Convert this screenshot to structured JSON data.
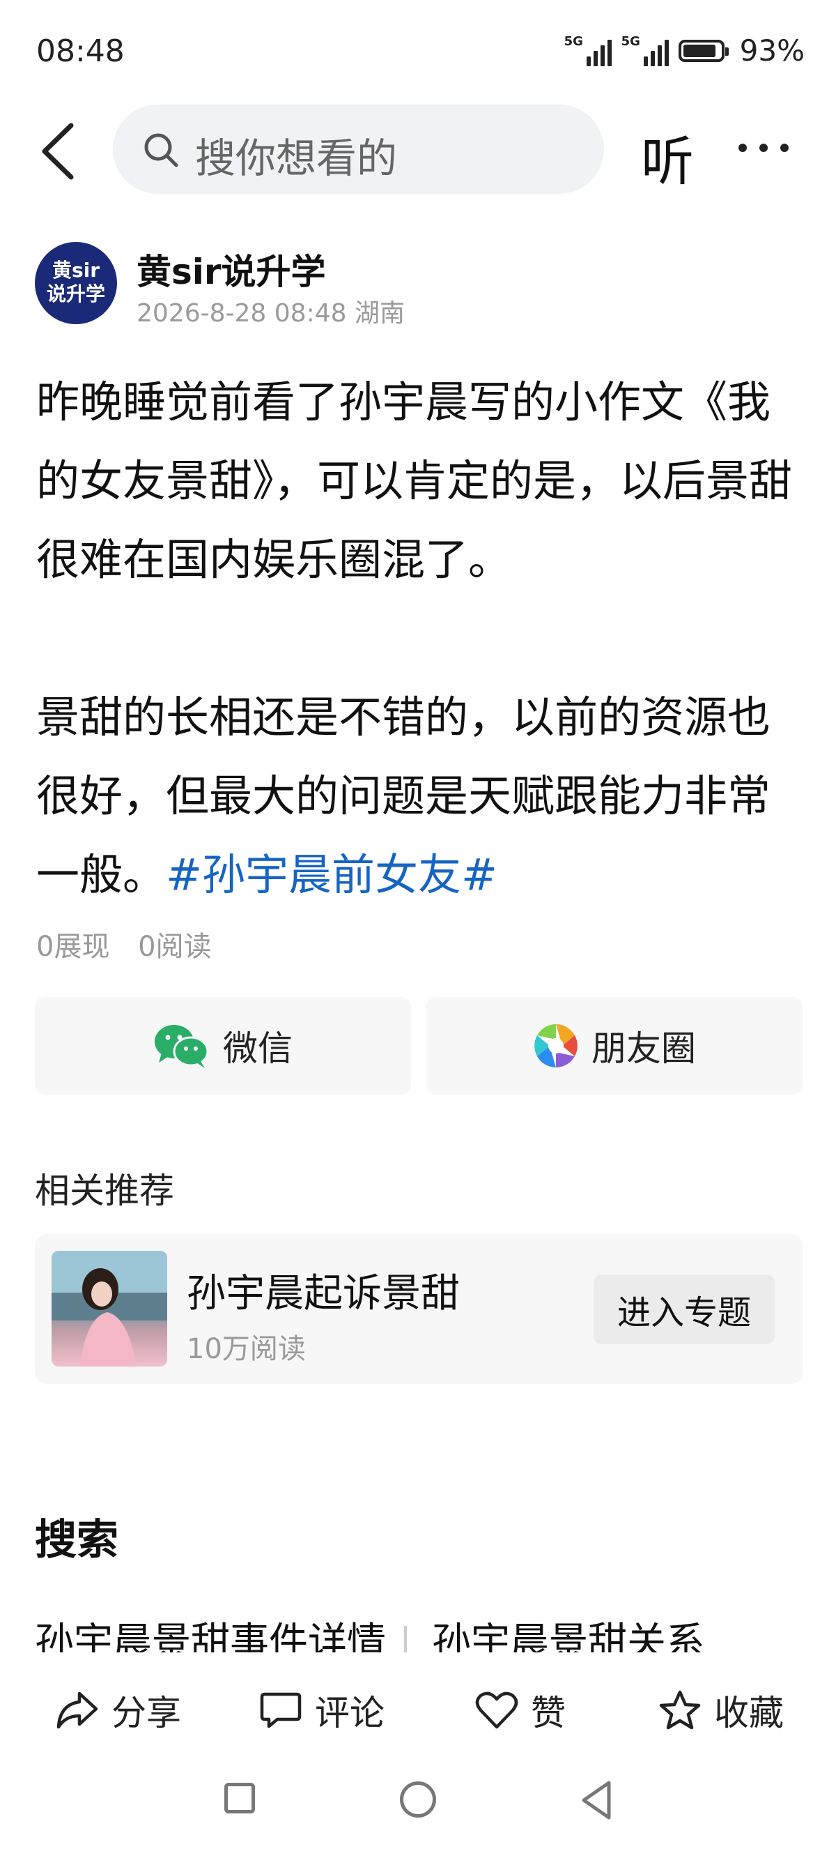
{
  "status_bar": {
    "time": "08:48",
    "network_1": "5G",
    "network_2": "5G",
    "battery_percent": "93%"
  },
  "nav": {
    "search_placeholder": "搜你想看的",
    "listen_label": "听"
  },
  "author": {
    "avatar_line1": "黄sir",
    "avatar_line2": "说升学",
    "name": "黄sir说升学",
    "meta": "2026-8-28 08:48 湖南"
  },
  "article": {
    "paragraph1": "昨晚睡觉前看了孙宇晨写的小作文《我的女友景甜》，可以肯定的是，以后景甜很难在国内娱乐圈混了。",
    "paragraph2_text": "景甜的长相还是不错的，以前的资源也很好，但最大的问题是天赋跟能力非常一般。",
    "hashtag": "#孙宇晨前女友#",
    "impressions": "0展现",
    "reads": "0阅读"
  },
  "share": {
    "wechat_label": "微信",
    "moments_label": "朋友圈"
  },
  "related": {
    "section_title": "相关推荐",
    "item_title": "孙宇晨起诉景甜",
    "item_reads": "10万阅读",
    "enter_label": "进入专题"
  },
  "search": {
    "heading": "搜索",
    "suggestions": [
      "孙宇晨景甜事件详情",
      "孙宇晨景甜关系"
    ]
  },
  "actions": {
    "share": "分享",
    "comment": "评论",
    "like": "赞",
    "favorite": "收藏"
  },
  "colors": {
    "hashtag": "#1664c4",
    "wechat_green": "#2aae67",
    "avatar_bg": "#1b2a78"
  }
}
